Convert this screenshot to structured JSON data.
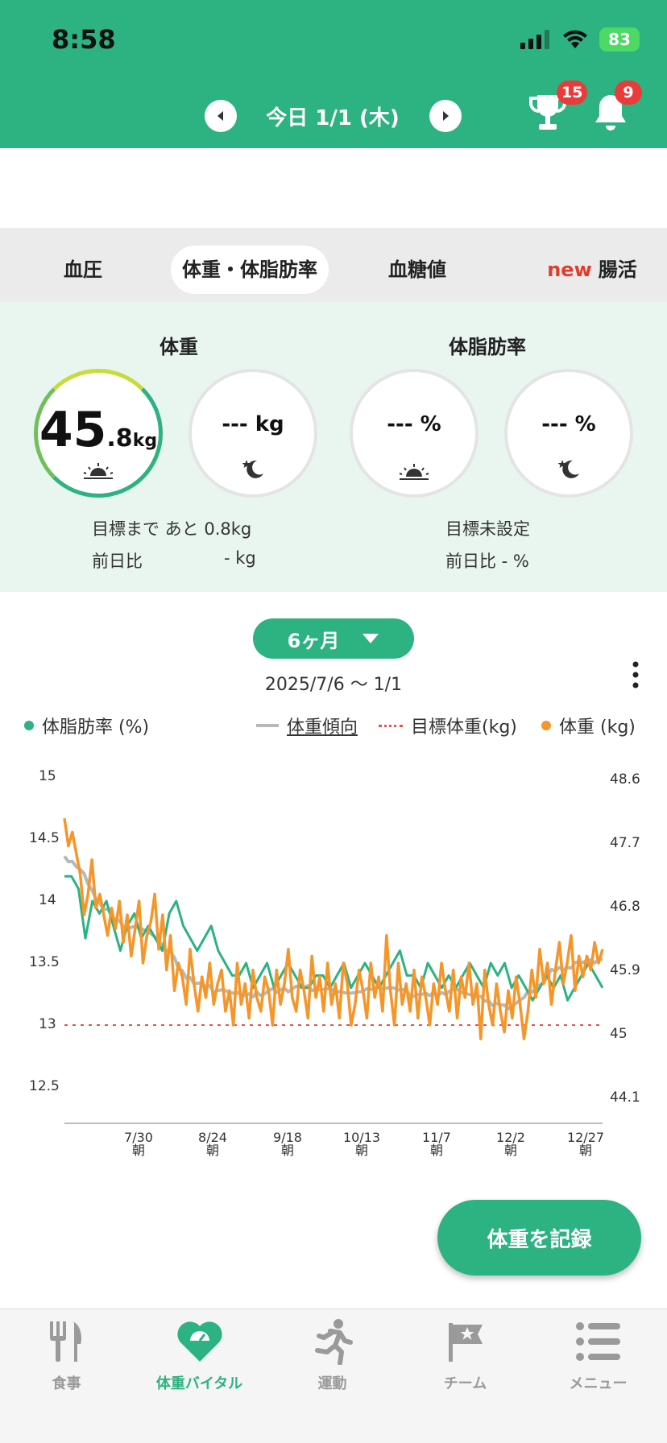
{
  "status_bar": {
    "time": "8:58",
    "battery": "83"
  },
  "header": {
    "date": "今日 1/1 (木)",
    "trophy_badge": "15",
    "bell_badge": "9"
  },
  "tabs": [
    {
      "label": "血圧",
      "new": "",
      "active": false
    },
    {
      "label": "体重・体脂肪率",
      "new": "",
      "active": true
    },
    {
      "label": "血糖値",
      "new": "",
      "active": false
    },
    {
      "label": "腸活",
      "new": "new",
      "active": false
    }
  ],
  "summary": {
    "weight_title": "体重",
    "fat_title": "体脂肪率",
    "weight_morning": {
      "int": "45",
      "dec": ".8",
      "unit": "kg"
    },
    "weight_night": "--- kg",
    "fat_morning": "--- %",
    "fat_night": "--- %",
    "weight_goal": "目標まで あと  0.8kg",
    "weight_diff_label": "前日比",
    "weight_diff_value": "- kg",
    "fat_goal": "目標未設定",
    "fat_diff": "前日比  - %"
  },
  "period": {
    "label": "6ヶ月",
    "range": "2025/7/6 〜 1/1"
  },
  "legend": {
    "fat": "体脂肪率 (%)",
    "trend": "体重傾向",
    "target": "目標体重(kg)",
    "weight": "体重 (kg)"
  },
  "colors": {
    "brand": "#2db281",
    "fat": "#2db281",
    "weight": "#f5962a",
    "trend": "#b8b8b8",
    "target": "#e85252",
    "badge": "#ea3b3b"
  },
  "chart_data": {
    "type": "line",
    "title": "",
    "left_axis": {
      "label": "体脂肪率 (%)",
      "ticks": [
        "15",
        "14.5",
        "14",
        "13.5",
        "13",
        "12.5"
      ],
      "ylim": [
        12.5,
        15
      ]
    },
    "right_axis": {
      "label": "体重 (kg)",
      "ticks": [
        "48.6",
        "47.7",
        "46.8",
        "45.9",
        "45",
        "44.1"
      ],
      "ylim": [
        44.1,
        48.6
      ]
    },
    "x_ticks": [
      {
        "date": "7/30",
        "sub": "朝"
      },
      {
        "date": "8/24",
        "sub": "朝"
      },
      {
        "date": "9/18",
        "sub": "朝"
      },
      {
        "date": "10/13",
        "sub": "朝"
      },
      {
        "date": "11/7",
        "sub": "朝"
      },
      {
        "date": "12/2",
        "sub": "朝"
      },
      {
        "date": "12/27",
        "sub": "朝"
      }
    ],
    "x_range": [
      "2025/7/6",
      "2026/1/1"
    ],
    "target_weight": 45.0,
    "series": [
      {
        "name": "体重 (kg)",
        "axis": "right",
        "values": [
          48.0,
          47.6,
          47.8,
          47.5,
          47.2,
          46.6,
          46.9,
          47.4,
          46.7,
          46.9,
          46.6,
          46.3,
          46.7,
          46.4,
          46.8,
          46.2,
          46.6,
          46.0,
          46.4,
          46.8,
          45.9,
          46.3,
          46.5,
          46.9,
          46.1,
          46.6,
          45.8,
          46.3,
          45.5,
          45.9,
          45.7,
          45.3,
          46.1,
          45.6,
          45.2,
          45.7,
          45.4,
          45.9,
          45.3,
          45.6,
          45.8,
          45.2,
          45.5,
          45.0,
          45.9,
          45.3,
          45.6,
          45.1,
          45.8,
          45.4,
          45.2,
          45.7,
          45.5,
          45.0,
          45.8,
          45.3,
          45.6,
          46.1,
          45.4,
          45.2,
          45.8,
          45.5,
          45.1,
          46.0,
          45.4,
          45.7,
          45.2,
          45.9,
          45.3,
          45.6,
          45.1,
          45.9,
          45.6,
          45.0,
          45.3,
          45.8,
          45.5,
          45.1,
          45.9,
          45.4,
          45.7,
          45.2,
          46.3,
          45.5,
          45.0,
          45.9,
          45.3,
          45.6,
          45.2,
          45.8,
          45.1,
          45.7,
          45.4,
          45.0,
          45.6,
          45.3,
          45.9,
          45.5,
          45.2,
          45.8,
          45.1,
          45.7,
          45.4,
          45.9,
          45.3,
          45.6,
          44.8,
          45.8,
          45.3,
          45.0,
          45.6,
          45.2,
          44.9,
          45.5,
          45.1,
          45.7,
          45.3,
          44.8,
          45.2,
          45.8,
          45.4,
          46.1,
          45.6,
          45.9,
          45.3,
          45.8,
          46.2,
          45.6,
          45.9,
          46.3,
          45.5,
          46.0,
          45.7,
          46.0,
          45.8,
          46.2,
          45.9,
          46.1
        ]
      },
      {
        "name": "体脂肪率 (%)",
        "axis": "left",
        "values": [
          14.2,
          14.2,
          14.1,
          13.7,
          14.0,
          13.9,
          14.0,
          13.8,
          13.6,
          13.8,
          13.9,
          13.7,
          13.8,
          13.7,
          13.6,
          13.9,
          14.0,
          13.8,
          13.7,
          13.6,
          13.7,
          13.8,
          13.6,
          13.5,
          13.4,
          13.4,
          13.5,
          13.3,
          13.4,
          13.5,
          13.3,
          13.4,
          13.5,
          13.4,
          13.3,
          13.3,
          13.4,
          13.4,
          13.3,
          13.4,
          13.5,
          13.3,
          13.4,
          13.5,
          13.4,
          13.3,
          13.4,
          13.5,
          13.6,
          13.4,
          13.4,
          13.3,
          13.5,
          13.4,
          13.3,
          13.4,
          13.3,
          13.4,
          13.5,
          13.4,
          13.3,
          13.5,
          13.4,
          13.5,
          13.3,
          13.4,
          13.3,
          13.2,
          13.3,
          13.4,
          13.3,
          13.4,
          13.2,
          13.3,
          13.4,
          13.5,
          13.4,
          13.3
        ]
      }
    ]
  },
  "record_button": "体重を記録",
  "bottom_nav": [
    {
      "label": "食事",
      "icon": "fork-knife-icon"
    },
    {
      "label": "体重バイタル",
      "icon": "heart-scale-icon"
    },
    {
      "label": "運動",
      "icon": "running-icon"
    },
    {
      "label": "チーム",
      "icon": "flag-star-icon"
    },
    {
      "label": "メニュー",
      "icon": "menu-list-icon"
    }
  ]
}
